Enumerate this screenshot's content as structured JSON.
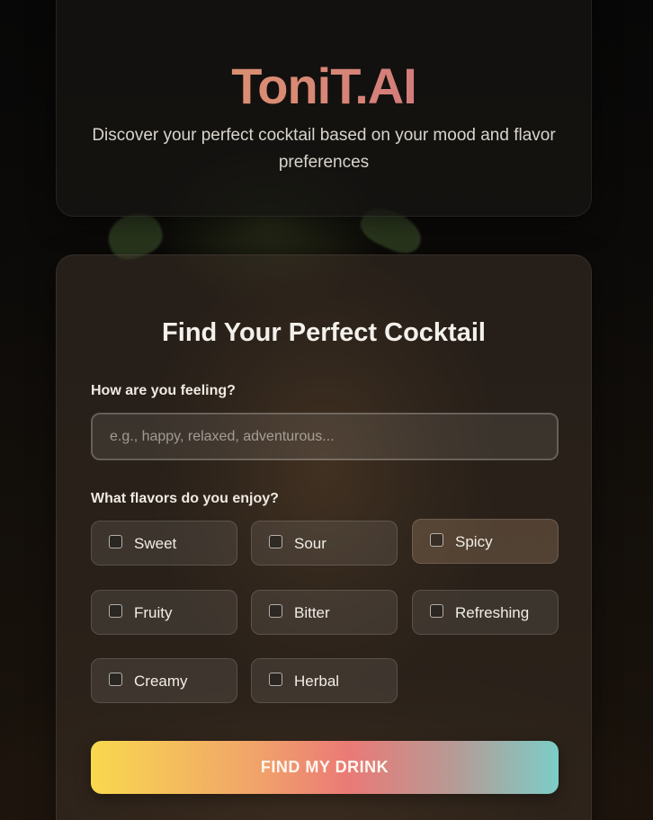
{
  "hero": {
    "brand": "ToniT.AI",
    "tagline": "Discover your perfect cocktail based on your mood and flavor preferences"
  },
  "form": {
    "title": "Find Your Perfect Cocktail",
    "mood_label": "How are you feeling?",
    "mood_placeholder": "e.g., happy, relaxed, adventurous...",
    "mood_value": "",
    "flavors_label": "What flavors do you enjoy?",
    "flavors": [
      {
        "label": "Sweet",
        "checked": false
      },
      {
        "label": "Sour",
        "checked": false
      },
      {
        "label": "Spicy",
        "checked": false
      },
      {
        "label": "Fruity",
        "checked": false
      },
      {
        "label": "Bitter",
        "checked": false
      },
      {
        "label": "Refreshing",
        "checked": false
      },
      {
        "label": "Creamy",
        "checked": false
      },
      {
        "label": "Herbal",
        "checked": false
      }
    ],
    "submit_label": "FIND MY DRINK"
  },
  "colors": {
    "brand_gradient": [
      "#d99a6a",
      "#d27a7c"
    ],
    "button_gradient": [
      "#f8d84e",
      "#ea7a76",
      "#7ccdc7"
    ],
    "background": "#0b0a09"
  }
}
